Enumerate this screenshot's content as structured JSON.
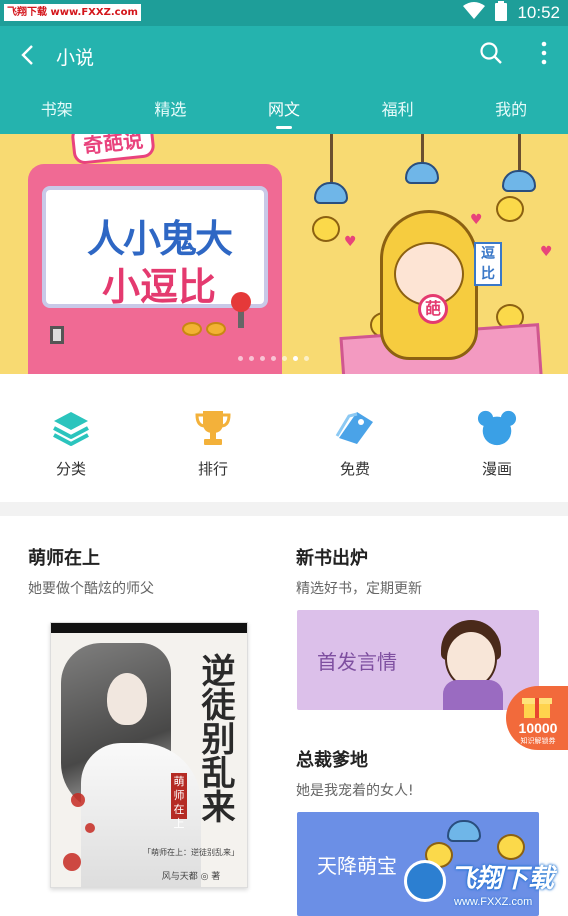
{
  "status_bar": {
    "watermark_tag": "飞翔下载 www.FXXZ.com",
    "time": "10:52",
    "wifi_icon": "wifi-icon",
    "battery_icon": "battery-icon"
  },
  "app_bar": {
    "title": "小说",
    "back_icon": "back-arrow-icon",
    "search_icon": "search-icon",
    "more_icon": "more-vert-icon",
    "background_color": "#25b3ae"
  },
  "tabs": [
    {
      "label": "书架",
      "active": false
    },
    {
      "label": "精选",
      "active": false
    },
    {
      "label": "网文",
      "active": true
    },
    {
      "label": "福利",
      "active": false
    },
    {
      "label": "我的",
      "active": false
    }
  ],
  "banner": {
    "brand": "奇葩说",
    "line1": "人小鬼大",
    "line2": "小逗比",
    "sign_text": "逗比",
    "badge_text": "葩",
    "page_count": 7,
    "active_page": 5
  },
  "shortcuts": [
    {
      "label": "分类",
      "icon": "layers-icon",
      "color": "#2bc4bd"
    },
    {
      "label": "排行",
      "icon": "trophy-icon",
      "color": "#f3b13a"
    },
    {
      "label": "免费",
      "icon": "free-tag-icon",
      "color": "#4aa3e8"
    },
    {
      "label": "漫画",
      "icon": "mickey-head-icon",
      "color": "#3aa0e6"
    }
  ],
  "sections": {
    "left": {
      "title": "萌师在上",
      "subtitle": "她要做个酷炫的师父",
      "cover": {
        "title": "逆徒别乱来",
        "seal": "萌师在上",
        "caption": "「萌师在上：逆徒别乱来」",
        "author": "风与天都 ◎ 著"
      }
    },
    "right_top": {
      "title": "新书出炉",
      "subtitle": "精选好书，定期更新",
      "card_text": "首发言情"
    },
    "right_bottom": {
      "title": "总裁爹地",
      "subtitle": "她是我宠着的女人!",
      "card_text": "天降萌宝"
    }
  },
  "floating_badge": {
    "number": "10000",
    "sub": "知识解锁券"
  },
  "watermark_logo": {
    "text": "飞翔下载",
    "url": "www.FXXZ.com"
  }
}
